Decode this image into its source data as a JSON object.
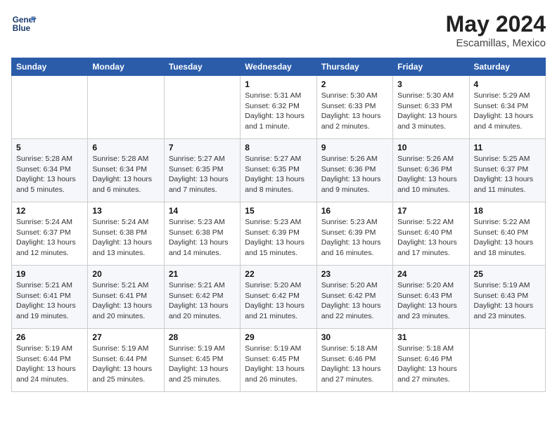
{
  "logo": {
    "line1": "General",
    "line2": "Blue"
  },
  "title": "May 2024",
  "subtitle": "Escamillas, Mexico",
  "days_header": [
    "Sunday",
    "Monday",
    "Tuesday",
    "Wednesday",
    "Thursday",
    "Friday",
    "Saturday"
  ],
  "weeks": [
    [
      {
        "day": "",
        "info": ""
      },
      {
        "day": "",
        "info": ""
      },
      {
        "day": "",
        "info": ""
      },
      {
        "day": "1",
        "info": "Sunrise: 5:31 AM\nSunset: 6:32 PM\nDaylight: 13 hours\nand 1 minute."
      },
      {
        "day": "2",
        "info": "Sunrise: 5:30 AM\nSunset: 6:33 PM\nDaylight: 13 hours\nand 2 minutes."
      },
      {
        "day": "3",
        "info": "Sunrise: 5:30 AM\nSunset: 6:33 PM\nDaylight: 13 hours\nand 3 minutes."
      },
      {
        "day": "4",
        "info": "Sunrise: 5:29 AM\nSunset: 6:34 PM\nDaylight: 13 hours\nand 4 minutes."
      }
    ],
    [
      {
        "day": "5",
        "info": "Sunrise: 5:28 AM\nSunset: 6:34 PM\nDaylight: 13 hours\nand 5 minutes."
      },
      {
        "day": "6",
        "info": "Sunrise: 5:28 AM\nSunset: 6:34 PM\nDaylight: 13 hours\nand 6 minutes."
      },
      {
        "day": "7",
        "info": "Sunrise: 5:27 AM\nSunset: 6:35 PM\nDaylight: 13 hours\nand 7 minutes."
      },
      {
        "day": "8",
        "info": "Sunrise: 5:27 AM\nSunset: 6:35 PM\nDaylight: 13 hours\nand 8 minutes."
      },
      {
        "day": "9",
        "info": "Sunrise: 5:26 AM\nSunset: 6:36 PM\nDaylight: 13 hours\nand 9 minutes."
      },
      {
        "day": "10",
        "info": "Sunrise: 5:26 AM\nSunset: 6:36 PM\nDaylight: 13 hours\nand 10 minutes."
      },
      {
        "day": "11",
        "info": "Sunrise: 5:25 AM\nSunset: 6:37 PM\nDaylight: 13 hours\nand 11 minutes."
      }
    ],
    [
      {
        "day": "12",
        "info": "Sunrise: 5:24 AM\nSunset: 6:37 PM\nDaylight: 13 hours\nand 12 minutes."
      },
      {
        "day": "13",
        "info": "Sunrise: 5:24 AM\nSunset: 6:38 PM\nDaylight: 13 hours\nand 13 minutes."
      },
      {
        "day": "14",
        "info": "Sunrise: 5:23 AM\nSunset: 6:38 PM\nDaylight: 13 hours\nand 14 minutes."
      },
      {
        "day": "15",
        "info": "Sunrise: 5:23 AM\nSunset: 6:39 PM\nDaylight: 13 hours\nand 15 minutes."
      },
      {
        "day": "16",
        "info": "Sunrise: 5:23 AM\nSunset: 6:39 PM\nDaylight: 13 hours\nand 16 minutes."
      },
      {
        "day": "17",
        "info": "Sunrise: 5:22 AM\nSunset: 6:40 PM\nDaylight: 13 hours\nand 17 minutes."
      },
      {
        "day": "18",
        "info": "Sunrise: 5:22 AM\nSunset: 6:40 PM\nDaylight: 13 hours\nand 18 minutes."
      }
    ],
    [
      {
        "day": "19",
        "info": "Sunrise: 5:21 AM\nSunset: 6:41 PM\nDaylight: 13 hours\nand 19 minutes."
      },
      {
        "day": "20",
        "info": "Sunrise: 5:21 AM\nSunset: 6:41 PM\nDaylight: 13 hours\nand 20 minutes."
      },
      {
        "day": "21",
        "info": "Sunrise: 5:21 AM\nSunset: 6:42 PM\nDaylight: 13 hours\nand 20 minutes."
      },
      {
        "day": "22",
        "info": "Sunrise: 5:20 AM\nSunset: 6:42 PM\nDaylight: 13 hours\nand 21 minutes."
      },
      {
        "day": "23",
        "info": "Sunrise: 5:20 AM\nSunset: 6:42 PM\nDaylight: 13 hours\nand 22 minutes."
      },
      {
        "day": "24",
        "info": "Sunrise: 5:20 AM\nSunset: 6:43 PM\nDaylight: 13 hours\nand 23 minutes."
      },
      {
        "day": "25",
        "info": "Sunrise: 5:19 AM\nSunset: 6:43 PM\nDaylight: 13 hours\nand 23 minutes."
      }
    ],
    [
      {
        "day": "26",
        "info": "Sunrise: 5:19 AM\nSunset: 6:44 PM\nDaylight: 13 hours\nand 24 minutes."
      },
      {
        "day": "27",
        "info": "Sunrise: 5:19 AM\nSunset: 6:44 PM\nDaylight: 13 hours\nand 25 minutes."
      },
      {
        "day": "28",
        "info": "Sunrise: 5:19 AM\nSunset: 6:45 PM\nDaylight: 13 hours\nand 25 minutes."
      },
      {
        "day": "29",
        "info": "Sunrise: 5:19 AM\nSunset: 6:45 PM\nDaylight: 13 hours\nand 26 minutes."
      },
      {
        "day": "30",
        "info": "Sunrise: 5:18 AM\nSunset: 6:46 PM\nDaylight: 13 hours\nand 27 minutes."
      },
      {
        "day": "31",
        "info": "Sunrise: 5:18 AM\nSunset: 6:46 PM\nDaylight: 13 hours\nand 27 minutes."
      },
      {
        "day": "",
        "info": ""
      }
    ]
  ]
}
